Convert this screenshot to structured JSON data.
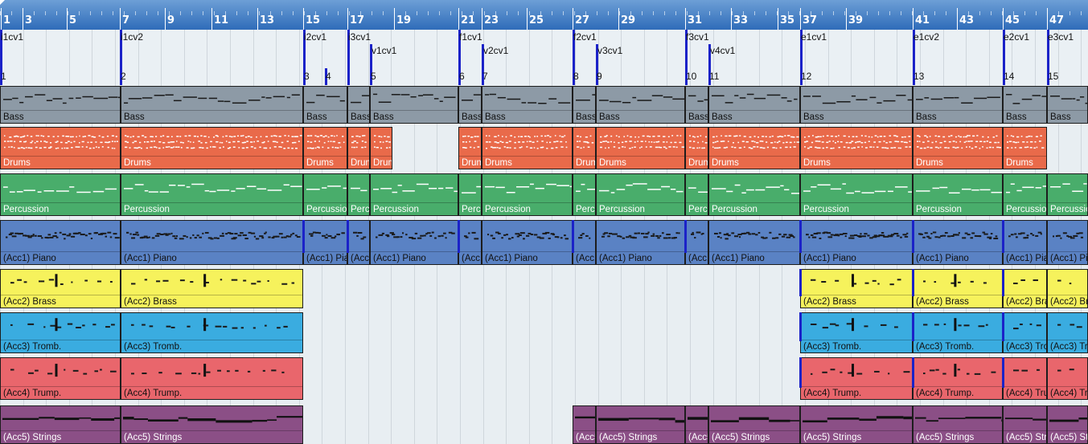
{
  "ruler": {
    "bar_numbers": [
      "1",
      "3",
      "5",
      "7",
      "9",
      "11",
      "13",
      "15",
      "17",
      "19",
      "21",
      "23",
      "25",
      "27",
      "29",
      "31",
      "33",
      "35",
      "37",
      "39",
      "41",
      "43",
      "45",
      "47"
    ]
  },
  "markers": {
    "rows": [
      [
        {
          "label": "i1cv1"
        },
        {
          "label": "i1cv2"
        },
        {
          "label": "i2cv1"
        },
        {
          "label": "i3cv1"
        },
        {
          "label": "f1cv1"
        },
        {
          "label": "f2cv1"
        },
        {
          "label": "f3cv1"
        },
        {
          "label": "e1cv1"
        },
        {
          "label": "e1cv2"
        },
        {
          "label": "e2cv1"
        },
        {
          "label": "e3cv1"
        }
      ],
      [
        {
          "label": "v1cv1"
        },
        {
          "label": "v2cv1"
        },
        {
          "label": "v3cv1"
        },
        {
          "label": "v4cv1"
        }
      ]
    ],
    "numbers": [
      "1",
      "2",
      "3",
      "4",
      "5",
      "6",
      "7",
      "8",
      "9",
      "10",
      "11",
      "12",
      "13",
      "14",
      "15"
    ]
  },
  "tracks": [
    {
      "key": "bass",
      "color": "#8d9aa6",
      "label_color": "#111111",
      "regions": [
        {
          "label": "Bass"
        },
        {
          "label": "Bass"
        },
        {
          "label": "Bass"
        },
        {
          "label": "Bass"
        },
        {
          "label": "Bass"
        },
        {
          "label": "Bass"
        },
        {
          "label": "Bass"
        },
        {
          "label": "Bass"
        },
        {
          "label": "Bass"
        },
        {
          "label": "Bass"
        },
        {
          "label": "Bass"
        },
        {
          "label": "Bass"
        },
        {
          "label": "Bass"
        },
        {
          "label": "Bass"
        },
        {
          "label": "Bass"
        }
      ]
    },
    {
      "key": "drums",
      "color": "#e96a4a",
      "label_color": "#ffffff",
      "regions": [
        {
          "label": "Drums"
        },
        {
          "label": "Drums"
        },
        {
          "label": "Drums"
        },
        {
          "label": "Drums"
        },
        {
          "label": "Drums"
        },
        {
          "label": "Drums"
        },
        {
          "label": "Drums"
        },
        {
          "label": "Drums"
        },
        {
          "label": "Drums"
        },
        {
          "label": "Drums"
        },
        {
          "label": "Drums"
        },
        {
          "label": "Drums"
        },
        {
          "label": "Drums"
        },
        {
          "label": "Drums"
        }
      ]
    },
    {
      "key": "percussion",
      "color": "#49ad6b",
      "label_color": "#ffffff",
      "regions": [
        {
          "label": "Percussion"
        },
        {
          "label": "Percussion"
        },
        {
          "label": "Percussion"
        },
        {
          "label": "Percussion"
        },
        {
          "label": "Percussion"
        },
        {
          "label": "Percussion"
        },
        {
          "label": "Percussion"
        },
        {
          "label": "Percussion"
        },
        {
          "label": "Percussion"
        },
        {
          "label": "Percussion"
        },
        {
          "label": "Percussion"
        },
        {
          "label": "Percussion"
        },
        {
          "label": "Percussion"
        },
        {
          "label": "Percussion"
        },
        {
          "label": "Percussion"
        }
      ]
    },
    {
      "key": "piano",
      "color": "#5a82c4",
      "label_color": "#111111",
      "regions": [
        {
          "label": "(Acc1) Piano"
        },
        {
          "label": "(Acc1) Piano"
        },
        {
          "label": "(Acc1) Piano"
        },
        {
          "label": "(Acc1) Piano"
        },
        {
          "label": "(Acc1) Piano"
        },
        {
          "label": "(Acc1) Piano"
        },
        {
          "label": "(Acc1) Piano"
        },
        {
          "label": "(Acc1) Piano"
        },
        {
          "label": "(Acc1) Piano"
        },
        {
          "label": "(Acc1) Piano"
        },
        {
          "label": "(Acc1) Piano"
        },
        {
          "label": "(Acc1) Piano"
        },
        {
          "label": "(Acc1) Piano"
        },
        {
          "label": "(Acc1) Piano"
        },
        {
          "label": "(Acc1) Piano"
        }
      ]
    },
    {
      "key": "brass",
      "color": "#f6f25c",
      "label_color": "#111111",
      "regions": [
        {
          "label": "(Acc2) Brass"
        },
        {
          "label": "(Acc2) Brass"
        },
        {
          "label": "(Acc2) Brass"
        },
        {
          "label": "(Acc2) Brass"
        },
        {
          "label": "(Acc2) Brass"
        },
        {
          "label": "(Acc2) Brass"
        }
      ]
    },
    {
      "key": "tromb",
      "color": "#3aace0",
      "label_color": "#111111",
      "regions": [
        {
          "label": "(Acc3) Tromb."
        },
        {
          "label": "(Acc3) Tromb."
        },
        {
          "label": "(Acc3) Tromb."
        },
        {
          "label": "(Acc3) Tromb."
        },
        {
          "label": "(Acc3) Tromb."
        },
        {
          "label": "(Acc3) Tromb."
        }
      ]
    },
    {
      "key": "trump",
      "color": "#e9666c",
      "label_color": "#111111",
      "regions": [
        {
          "label": "(Acc4) Trump."
        },
        {
          "label": "(Acc4) Trump."
        },
        {
          "label": "(Acc4) Trump."
        },
        {
          "label": "(Acc4) Trump."
        },
        {
          "label": "(Acc4) Trump."
        },
        {
          "label": "(Acc4) Trump."
        }
      ]
    },
    {
      "key": "strings",
      "color": "#8b4f86",
      "label_color": "#ffffff",
      "regions": [
        {
          "label": "(Acc5) Strings"
        },
        {
          "label": "(Acc5) Strings"
        },
        {
          "label": "(Acc5) Strings"
        },
        {
          "label": "(Acc5) Strings"
        },
        {
          "label": "(Acc5) Strings"
        },
        {
          "label": "(Acc5) Strings"
        },
        {
          "label": "(Acc5) Strings"
        },
        {
          "label": "(Acc5) Strings"
        },
        {
          "label": "(Acc5) Strings"
        },
        {
          "label": "(Acc5) Strings"
        }
      ]
    }
  ]
}
